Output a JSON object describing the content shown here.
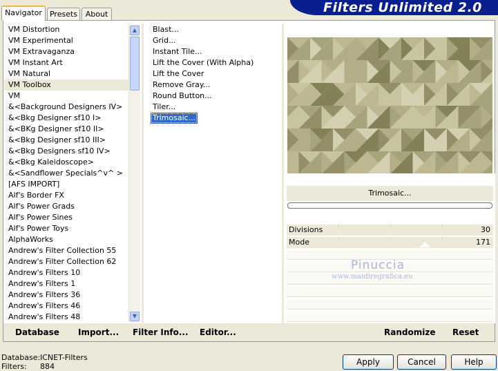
{
  "header": {
    "title": "Filters Unlimited 2.0"
  },
  "tabs": [
    {
      "label": "Navigator",
      "active": true
    },
    {
      "label": "Presets",
      "active": false
    },
    {
      "label": "About",
      "active": false
    }
  ],
  "categories": [
    "VM Distortion",
    "VM Experimental",
    "VM Extravaganza",
    "VM Instant Art",
    "VM Natural",
    "VM Toolbox",
    "VM",
    "&<Background Designers IV>",
    "&<Bkg Designer sf10 I>",
    "&<BKg Designer sf10 II>",
    "&<Bkg Designer sf10 III>",
    "&<Bkg Designers sf10 IV>",
    "&<Bkg Kaleidoscope>",
    "&<Sandflower Specials^v^ >",
    "[AFS IMPORT]",
    "Alf's Border FX",
    "Alf's Power Grads",
    "Alf's Power Sines",
    "Alf's Power Toys",
    "AlphaWorks",
    "Andrew's Filter Collection 55",
    "Andrew's Filter Collection 62",
    "Andrew's Filters 10",
    "Andrew's Filters 1",
    "Andrew's Filters 36",
    "Andrew's Filters 46",
    "Andrew's Filters 48"
  ],
  "selected_category": "VM Toolbox",
  "filters": [
    "Blast...",
    "Grid...",
    "Instant Tile...",
    "Lift the Cover (With Alpha)",
    "Lift the Cover",
    "Remove Gray...",
    "Round Button...",
    "Tiler...",
    "Trimosaic..."
  ],
  "selected_filter": "Trimosaic...",
  "preview": {
    "filter_name": "Trimosaic...",
    "colors": [
      "#c9c4a0",
      "#bdb892",
      "#a7a37c",
      "#948f68",
      "#848058",
      "#d3cfb0",
      "#b3ae88"
    ]
  },
  "params": [
    {
      "label": "Divisions",
      "value": "30"
    },
    {
      "label": "Mode",
      "value": "171"
    }
  ],
  "watermark": {
    "name": "Pinuccia",
    "site": "www.maidiregrafica.eu"
  },
  "toolbar": {
    "database": "Database",
    "import": "Import...",
    "filter_info": "Filter Info...",
    "editor": "Editor...",
    "randomize": "Randomize",
    "reset": "Reset"
  },
  "status": {
    "database_label": "Database:",
    "database_value": "ICNET-Filters",
    "filters_label": "Filters:",
    "filters_value": "884"
  },
  "buttons": {
    "apply": "Apply",
    "cancel": "Cancel",
    "help": "Help"
  }
}
